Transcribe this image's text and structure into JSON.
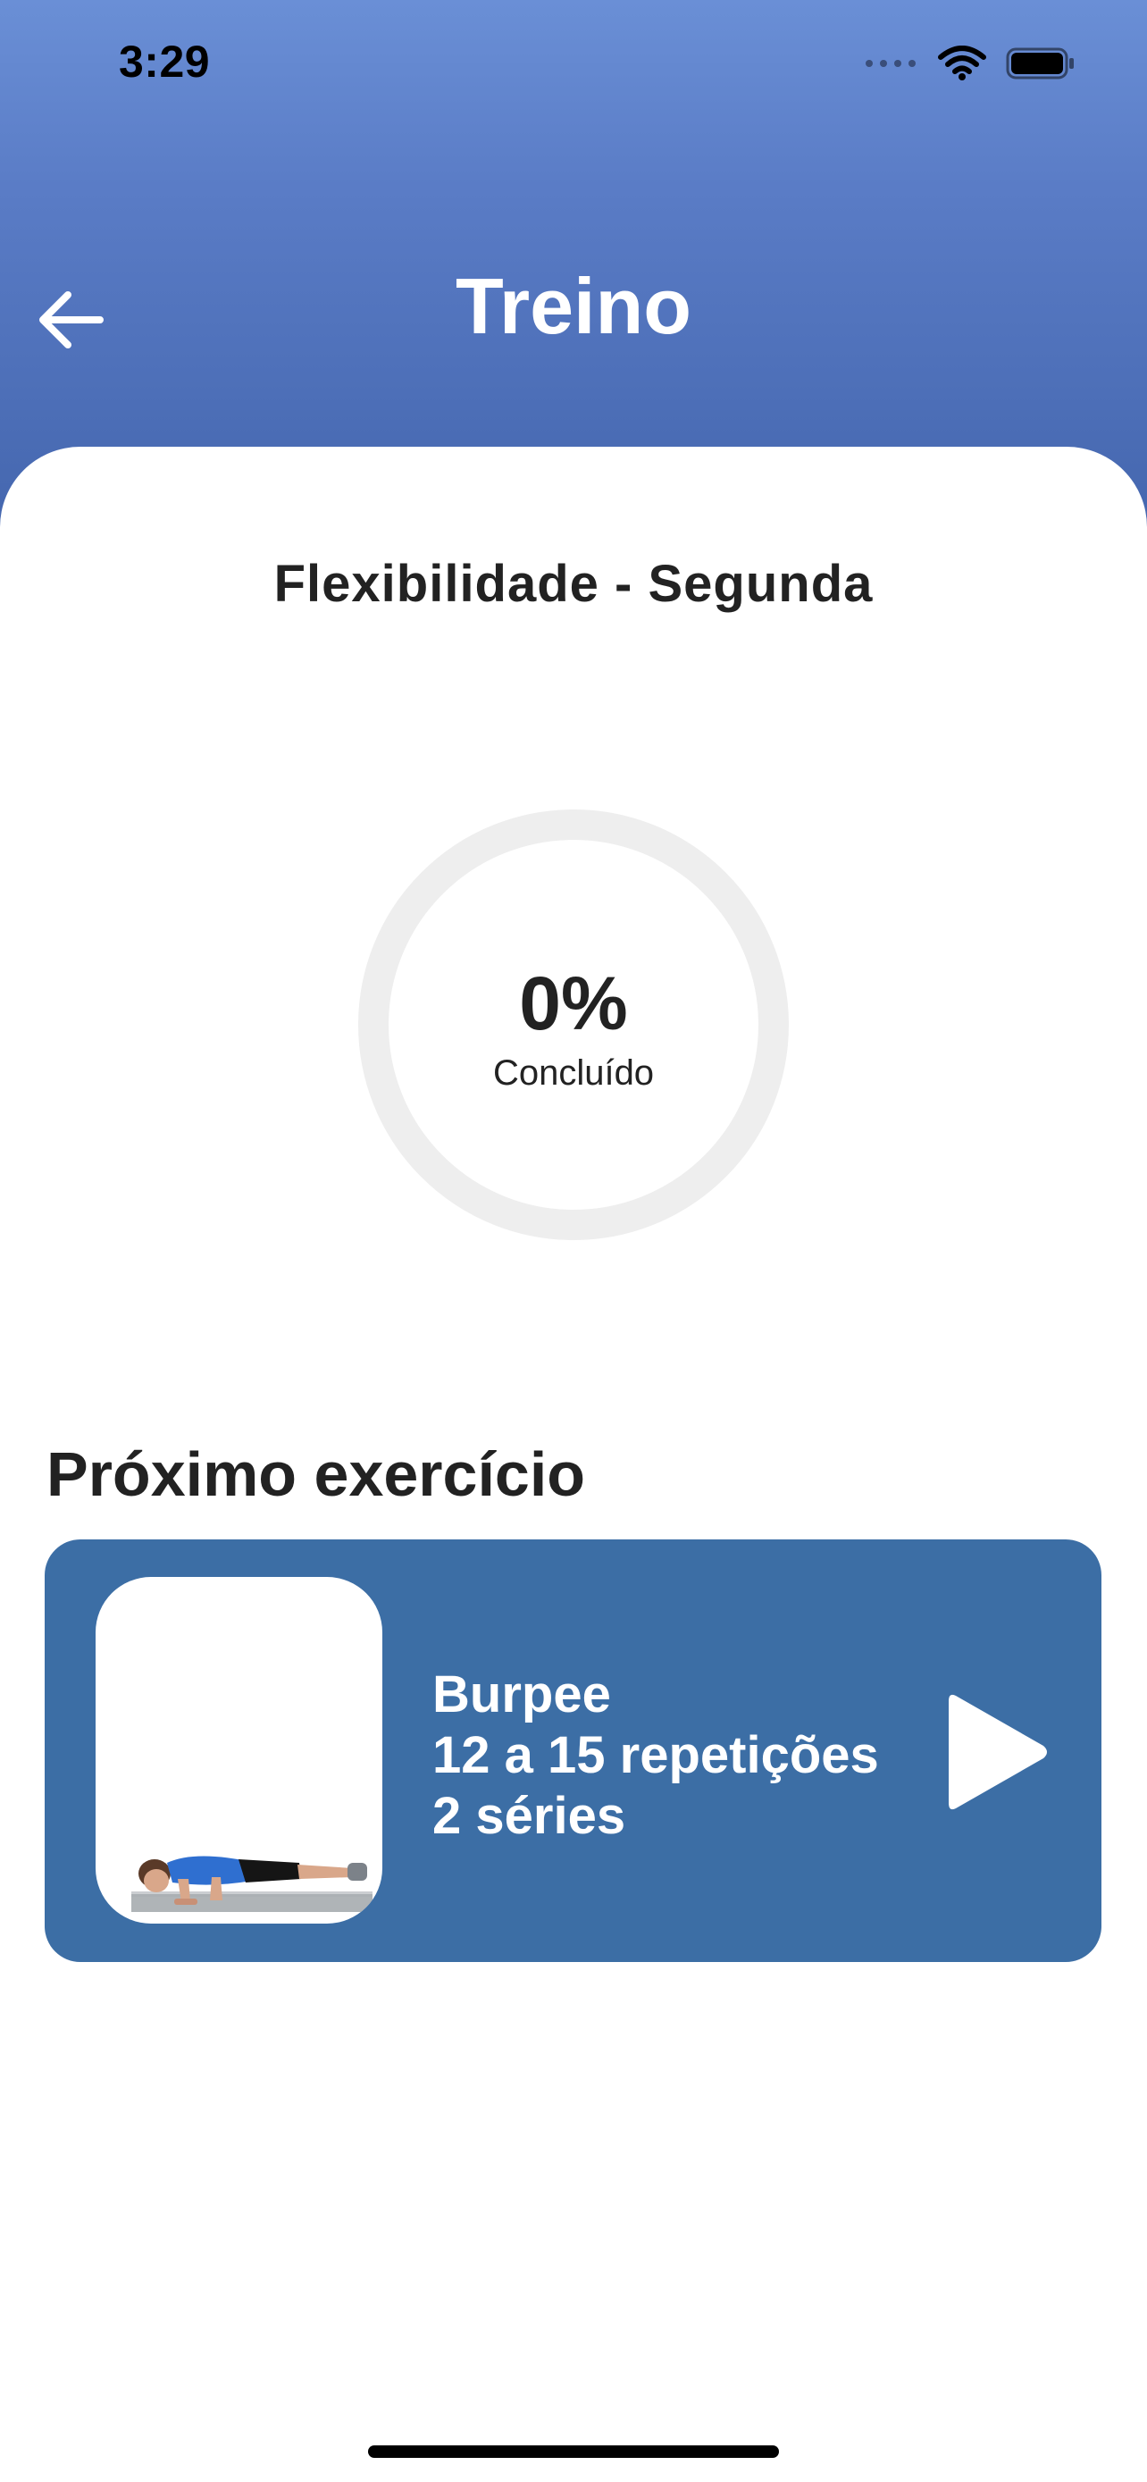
{
  "status_bar": {
    "time": "3:29",
    "icons": [
      "signal-dots-icon",
      "wifi-icon",
      "battery-icon"
    ]
  },
  "header": {
    "title": "Treino",
    "back_icon": "arrow-left-icon"
  },
  "workout": {
    "name": "Flexibilidade - Segunda",
    "progress_percent": 0,
    "progress_value": "0%",
    "progress_label": "Concluído"
  },
  "next_exercise": {
    "heading": "Próximo exercício",
    "name": "Burpee",
    "reps": "12 a 15 repetições",
    "sets": "2 séries",
    "play_icon": "play-icon"
  },
  "colors": {
    "header_gradient_top": "#6A8FD6",
    "header_gradient_bottom": "#4466AE",
    "card_background": "#3C6EA5",
    "ring_track": "#EEEEEE",
    "text_dark": "#222222"
  }
}
